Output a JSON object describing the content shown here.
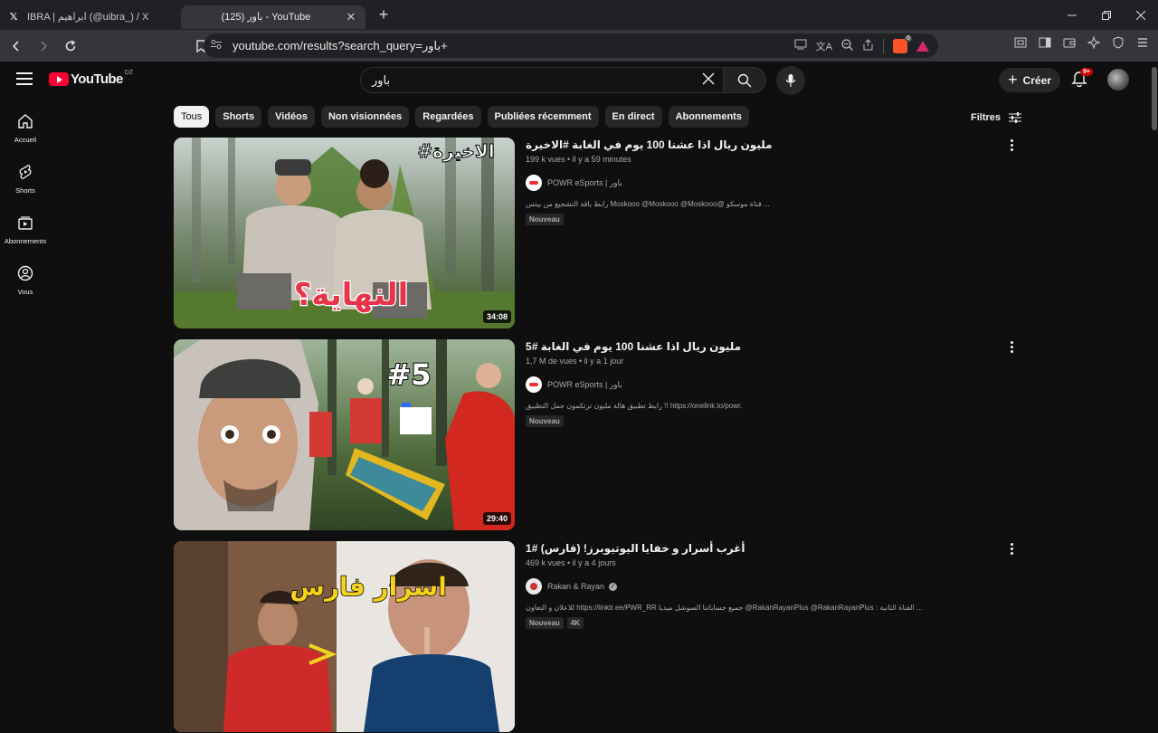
{
  "browser": {
    "tabs": [
      {
        "title": "IBRA | ابراهيم (@uibra_) / X",
        "icon": "x-logo-icon",
        "active": false
      },
      {
        "title": "(125) باور - YouTube",
        "icon": "youtube-icon",
        "active": true
      }
    ],
    "close_glyph": "✕",
    "new_tab_glyph": "+",
    "url": "youtube.com/results?search_query=باور+",
    "brave_count": "6"
  },
  "youtube": {
    "logo_text": "YouTube",
    "country_code": "DZ",
    "search_query": "باور",
    "create_label": "Créer",
    "notif_count": "9+",
    "guide": [
      {
        "label": "Accueil",
        "icon": "home-icon"
      },
      {
        "label": "Shorts",
        "icon": "shorts-icon"
      },
      {
        "label": "Abonnements",
        "icon": "subscriptions-icon"
      },
      {
        "label": "Vous",
        "icon": "you-icon"
      }
    ],
    "chips": [
      "Tous",
      "Shorts",
      "Vidéos",
      "Non visionnées",
      "Regardées",
      "Publiées récemment",
      "En direct",
      "Abonnements"
    ],
    "filters_label": "Filtres",
    "videos": [
      {
        "title": "مليون ريال اذا عشنا 100 يوم في الغابة #الاخيرة",
        "stats": "199 k vues • il y a 59 minutes",
        "channel": "POWR eSports | باور",
        "description": "رابط باقة التشجيع من بيتس Moskooo @Moskooo @Moskooo@ قناة موسكو ...",
        "badges": [
          "Nouveau"
        ],
        "duration": "34:08",
        "thumb_caption": "النهاية؟",
        "thumb_tag": "#الاخيرة"
      },
      {
        "title": "مليون ريال اذا عشنا 100 يوم في الغابة #5",
        "stats": "1,7 M de vues • il y a 1 jour",
        "channel": "POWR eSports | باور",
        "description": "رابط تطبيق هالة مليون ترتكمون حمل التطبيق !! https://onelink.to/powr.",
        "badges": [
          "Nouveau"
        ],
        "duration": "29:40",
        "thumb_tag": "#5"
      },
      {
        "title": "أغرب أسرار و خفايا اليوتيوبرز! (فارس) #1",
        "stats": "469 k vues • il y a 4 jours",
        "channel": "Rakan & Rayan",
        "description": "للاعلان و التعاون https://linktr.ee/PWR_RR جميع حساباتنا السوشل ميديا @RakanRayanPlus @RakanRayanPlus : القناة الثانية ...",
        "badges": [
          "Nouveau",
          "4K"
        ],
        "thumb_caption": "اسرار فارس"
      }
    ]
  }
}
